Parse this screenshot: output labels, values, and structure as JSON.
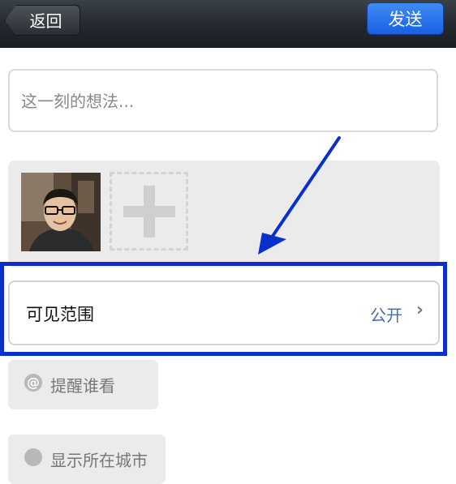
{
  "nav": {
    "back_label": "返回",
    "send_label": "发送"
  },
  "post": {
    "placeholder": "这一刻的想法..."
  },
  "visibility": {
    "label": "可见范围",
    "value": "公开",
    "chevron": "›"
  },
  "mention": {
    "icon": "@",
    "label": "提醒谁看"
  },
  "location": {
    "label": "显示所在城市"
  },
  "colors": {
    "highlight": "#0b2fcb",
    "send_button": "#2f7ae8",
    "link_value": "#4b6da8"
  }
}
